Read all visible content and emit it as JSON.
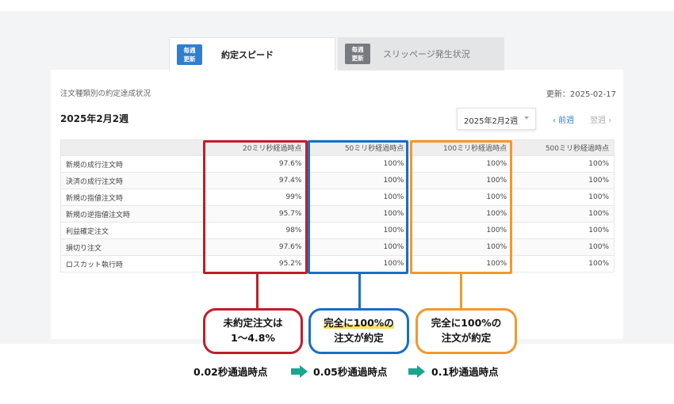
{
  "tabs": [
    {
      "badge_line1": "毎週",
      "badge_line2": "更新",
      "label": "約定スピード"
    },
    {
      "badge_line1": "毎週",
      "badge_line2": "更新",
      "label": "スリッページ発生状況"
    }
  ],
  "header": {
    "subtitle": "注文種類別の約定達成状況",
    "updated": "更新：2025-02-17",
    "week_title": "2025年2月2週"
  },
  "controls": {
    "week_select_value": "2025年2月2週",
    "prev_week": "‹ 前週",
    "next_week": "翌週 ›"
  },
  "table": {
    "columns": [
      "",
      "20ミリ秒経過時点",
      "50ミリ秒経過時点",
      "100ミリ秒経過時点",
      "500ミリ秒経過時点"
    ],
    "rows": [
      [
        "新規の成行注文時",
        "97.6%",
        "100%",
        "100%",
        "100%"
      ],
      [
        "決済の成行注文時",
        "97.4%",
        "100%",
        "100%",
        "100%"
      ],
      [
        "新規の指値注文時",
        "99%",
        "100%",
        "100%",
        "100%"
      ],
      [
        "新規の逆指値注文時",
        "95.7%",
        "100%",
        "100%",
        "100%"
      ],
      [
        "利益確定注文",
        "98%",
        "100%",
        "100%",
        "100%"
      ],
      [
        "損切り注文",
        "97.6%",
        "100%",
        "100%",
        "100%"
      ],
      [
        "ロスカット執行時",
        "95.2%",
        "100%",
        "100%",
        "100%"
      ]
    ]
  },
  "callouts": {
    "red": {
      "line1": "未約定注文は",
      "line2": "1〜4.8%",
      "color": "#c21d2b"
    },
    "blue": {
      "line1": "完全に100%の",
      "line2": "注文が約定",
      "color": "#1a6fc4"
    },
    "orange": {
      "line1": "完全に100%の",
      "line2": "注文が約定",
      "color": "#f1992d"
    }
  },
  "flow": [
    "0.02秒通過時点",
    "0.05秒通過時点",
    "0.1秒通過時点"
  ],
  "colors": {
    "accent": "#2f7fd1",
    "arrow": "#1ba58f"
  }
}
